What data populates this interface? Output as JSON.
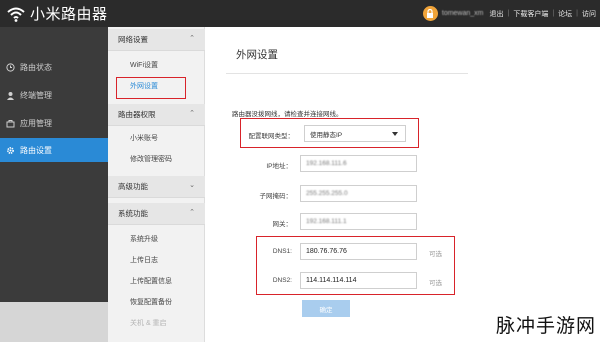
{
  "header": {
    "brand": "小米路由器",
    "user": "tomewan_xm",
    "links": [
      "退出",
      "下载客户端",
      "论坛",
      "访问"
    ]
  },
  "sidebar": {
    "items": [
      {
        "label": "路由状态",
        "icon": "clock-icon"
      },
      {
        "label": "终端管理",
        "icon": "user-icon"
      },
      {
        "label": "应用管理",
        "icon": "briefcase-icon"
      },
      {
        "label": "路由设置",
        "icon": "gear-icon",
        "active": true
      }
    ]
  },
  "submenu": {
    "groups": [
      {
        "title": "网络设置",
        "expanded": true,
        "items": [
          "WiFi设置",
          "外网设置"
        ]
      },
      {
        "title": "路由器权限",
        "expanded": true,
        "items": [
          "小米账号",
          "修改管理密码"
        ]
      },
      {
        "title": "高级功能",
        "expanded": false,
        "items": []
      },
      {
        "title": "系统功能",
        "expanded": true,
        "items": [
          "系统升级",
          "上传日志",
          "上传配置信息",
          "恢复配置备份",
          "关机 & 重启"
        ]
      }
    ],
    "selected": "外网设置"
  },
  "main": {
    "title": "外网设置",
    "notice": "路由器没拨网线，请检查并连接网线。",
    "connection_type_label": "配置联网类型：",
    "connection_type_value": "使用静态IP",
    "ip_label": "IP地址：",
    "ip_value": "192.168.111.6",
    "mask_label": "子网掩码：",
    "mask_value": "255.255.255.0",
    "gateway_label": "网关：",
    "gateway_value": "192.168.111.1",
    "dns1_label": "DNS1:",
    "dns1_value": "180.76.76.76",
    "dns2_label": "DNS2:",
    "dns2_value": "114.114.114.114",
    "optional": "可选",
    "apply": "确定"
  },
  "watermark": "脉冲手游网",
  "colors": {
    "accent": "#2a8ad6",
    "highlight": "#d8232a",
    "topbar": "#2b2b2b",
    "sidebar": "#3b3b3b"
  }
}
